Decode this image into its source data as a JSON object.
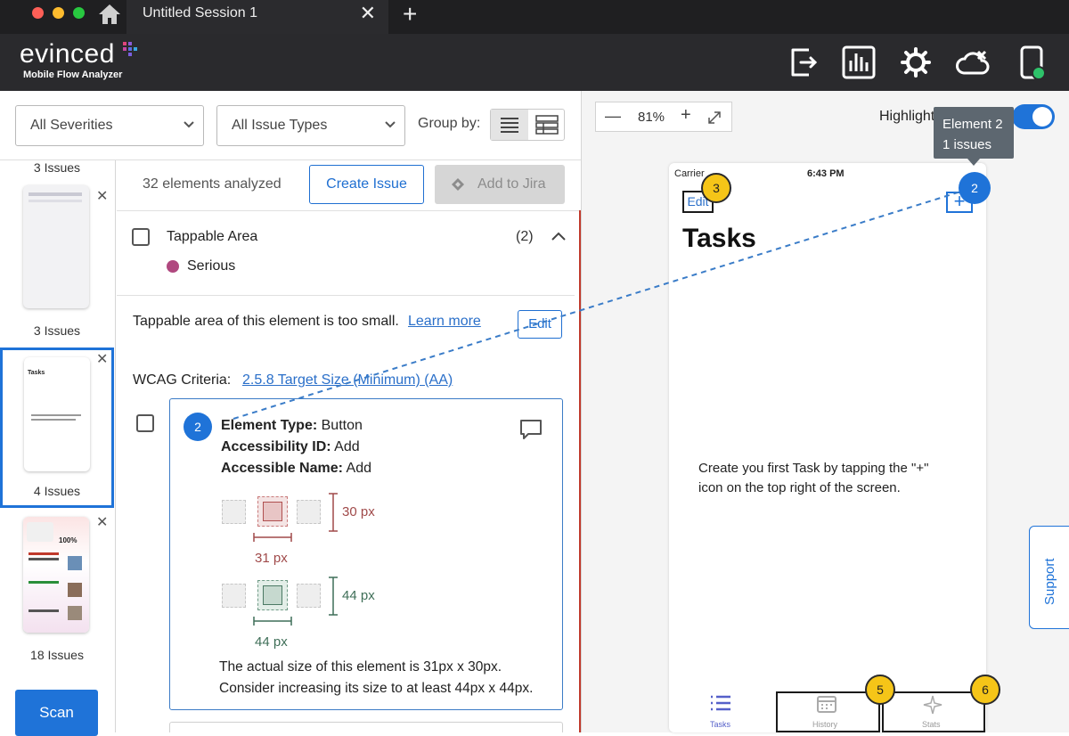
{
  "window": {
    "tab_title": "Untitled Session 1",
    "tab_close": "✕",
    "new_tab": "+"
  },
  "header": {
    "brand": "evinced",
    "subtitle": "Mobile Flow Analyzer"
  },
  "filters": {
    "severity": "All Severities",
    "issue_types": "All Issue Types",
    "group_by_label": "Group by:"
  },
  "thumbnails": [
    {
      "top_label": "3 Issues"
    },
    {
      "label": "3 Issues"
    },
    {
      "label": "4 Issues",
      "title": "Tasks"
    },
    {
      "label": "18 Issues",
      "percent": "100%"
    }
  ],
  "scan_label": "Scan",
  "issues_panel": {
    "elements_analyzed": "32 elements analyzed",
    "create_issue": "Create Issue",
    "add_to_jira": "Add to Jira",
    "issue_title": "Tappable Area",
    "issue_count": "(2)",
    "severity": "Serious",
    "severity_color": "#b0487f",
    "description": "Tappable area of this element is too small.",
    "learn_more": "Learn more",
    "wcag_label": "WCAG Criteria:",
    "wcag_link": "2.5.8 Target Size (Minimum) (AA)",
    "element": {
      "number": "2",
      "type_label": "Element Type:",
      "type_value": "Button",
      "id_label": "Accessibility ID:",
      "id_value": "Add",
      "name_label": "Accessible Name:",
      "name_value": "Add",
      "actual_h": "30 px",
      "actual_w": "31 px",
      "target_h": "44 px",
      "target_w": "44 px",
      "summary_1": "The actual size of this element is 31px x 30px.",
      "summary_2": "Consider increasing its size to at least 44px x 44px."
    }
  },
  "preview": {
    "zoom": "81%",
    "zoom_out": "—",
    "zoom_in": "+",
    "highlight_label": "Highlight",
    "tooltip_line1": "Element 2",
    "tooltip_line2": "1 issues",
    "phone": {
      "carrier": "Carrier",
      "time": "6:43 PM",
      "edit": "Edit",
      "title": "Tasks",
      "empty_text_1": "Create you first Task by tapping the \"+\"",
      "empty_text_2": "icon on the top right of the screen.",
      "tabs": [
        "Tasks",
        "History",
        "Stats"
      ]
    },
    "badges": [
      "3",
      "2",
      "5",
      "6"
    ],
    "support": "Support"
  }
}
